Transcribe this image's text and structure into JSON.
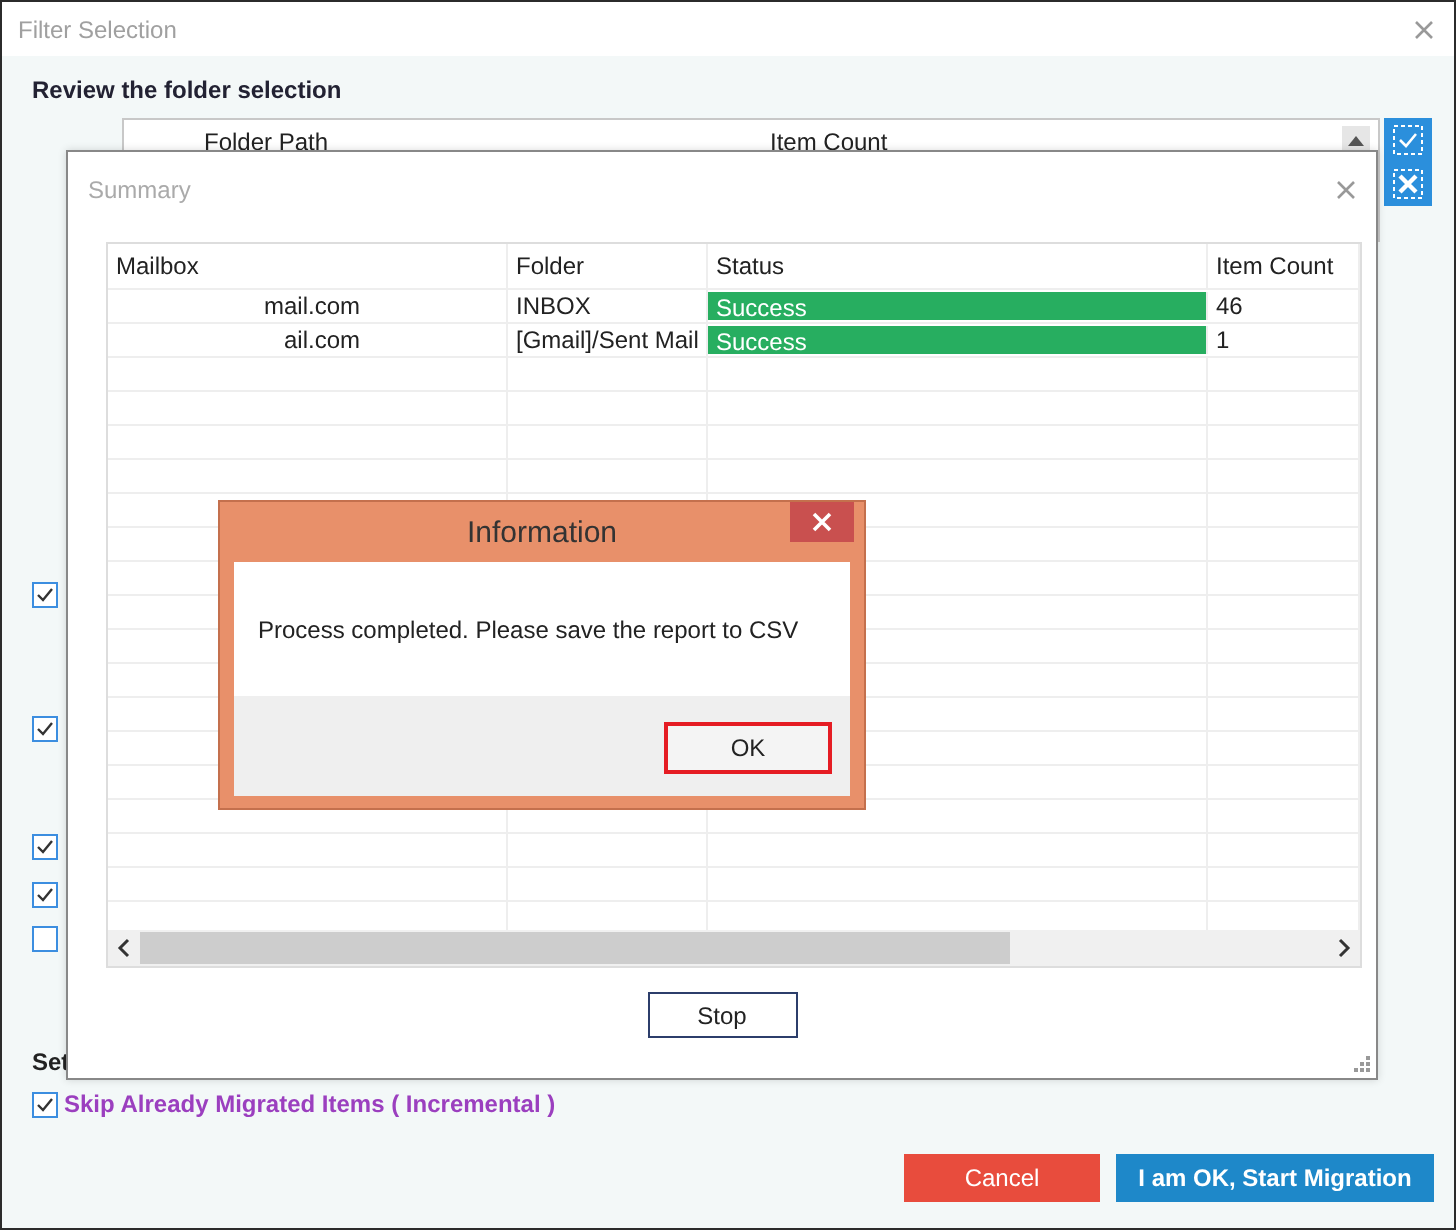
{
  "window": {
    "title": "Filter Selection"
  },
  "review": {
    "heading": "Review the folder selection",
    "columns": [
      "Folder Path",
      "Item Count"
    ]
  },
  "options": [
    {
      "checked": true
    },
    {
      "checked": true
    },
    {
      "checked": true
    },
    {
      "checked": true
    },
    {
      "checked": false
    }
  ],
  "settings": {
    "heading": "Set"
  },
  "skip": {
    "label": "Skip Already Migrated Items ( Incremental )",
    "checked": true
  },
  "buttons": [
    {
      "label": "Cancel",
      "kind": "cancel"
    },
    {
      "label": "I am OK, Start Migration",
      "kind": "primary"
    }
  ],
  "summary": {
    "title": "Summary",
    "columns": [
      "Mailbox",
      "Folder",
      "Status",
      "Item Count"
    ],
    "rows": [
      {
        "mailbox": "mail.com",
        "folder": "INBOX",
        "status": "Success",
        "count": "46"
      },
      {
        "mailbox": "ail.com",
        "folder": "[Gmail]/Sent Mail",
        "status": "Success",
        "count": "1"
      }
    ],
    "stop": "Stop"
  },
  "info": {
    "title": "Information",
    "message": "Process completed. Please save the report to CSV",
    "ok": "OK"
  }
}
